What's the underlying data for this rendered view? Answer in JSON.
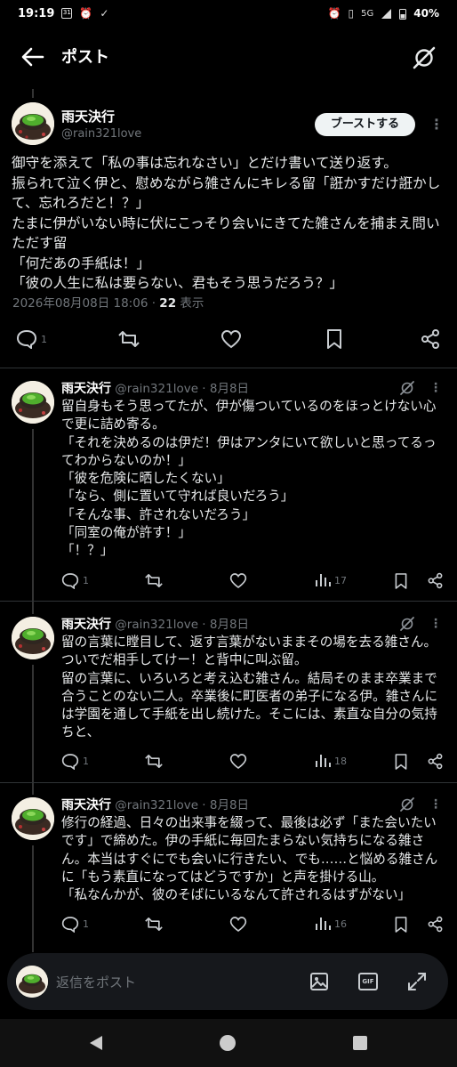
{
  "status_bar": {
    "time": "19:19",
    "calendar_badge": "31",
    "network": "5G",
    "battery": "40%"
  },
  "header": {
    "title": "ポスト"
  },
  "main_post": {
    "display_name": "雨天決行",
    "handle": "@rain321love",
    "boost_label": "ブーストする",
    "text": "御守を添えて「私の事は忘れなさい」とだけ書いて送り返す。\n振られて泣く伊と、慰めながら雑さんにキレる留「誑かすだけ誑かして、忘れろだと！？」\nたまに伊がいない時に伏にこっそり会いにきてた雑さんを捕まえ問いただす留\n「何だあの手紙は！」\n「彼の人生に私は要らない、君もそう思うだろう？」",
    "timestamp": "2026年08月08日 18:06",
    "separator": " · ",
    "views_count": "22",
    "views_label": " 表示",
    "reply_count": "1"
  },
  "replies": [
    {
      "display_name": "雨天決行",
      "handle_date": " @rain321love · 8月8日",
      "text": "留自身もそう思ってたが、伊が傷ついているのをほっとけない心で更に詰め寄る。\n「それを決めるのは伊だ！伊はアンタにいて欲しいと思ってるってわからないのか！」\n「彼を危険に晒したくない」\n「なら、側に置いて守れば良いだろう」\n「そんな事、許されないだろう」\n「同室の俺が許す！」\n「！？」",
      "reply_count": "1",
      "views": "17"
    },
    {
      "display_name": "雨天決行",
      "handle_date": " @rain321love · 8月8日",
      "text": "留の言葉に瞠目して、返す言葉がないままその場を去る雑さん。ついでだ相手してけー！と背中に叫ぶ留。\n留の言葉に、いろいろと考え込む雑さん。結局そのまま卒業まで合うことのない二人。卒業後に町医者の弟子になる伊。雑さんには学園を通して手紙を出し続けた。そこには、素直な自分の気持ちと、",
      "reply_count": "1",
      "views": "18"
    },
    {
      "display_name": "雨天決行",
      "handle_date": " @rain321love · 8月8日",
      "text": "修行の経過、日々の出来事を綴って、最後は必ず「また会いたいです」で締めた。伊の手紙に毎回たまらない気持ちになる雑さん。本当はすぐにでも会いに行きたい、でも……と悩める雑さんに「もう素直になってはどうですか」と声を掛ける山。\n「私なんかが、彼のそばにいるなんて許されるはずがない」",
      "reply_count": "1",
      "views": "16"
    }
  ],
  "composer": {
    "placeholder": "返信をポスト",
    "gif_label": "GIF"
  },
  "colors": {
    "background": "#000000",
    "text": "#e7e9ea",
    "secondary": "#71767b",
    "divider": "#2f3336"
  },
  "icons": [
    "back-arrow-icon",
    "grok-icon",
    "reply-icon",
    "repost-icon",
    "like-icon",
    "bookmark-icon",
    "share-icon",
    "views-icon",
    "image-icon",
    "gif-icon",
    "expand-icon"
  ]
}
